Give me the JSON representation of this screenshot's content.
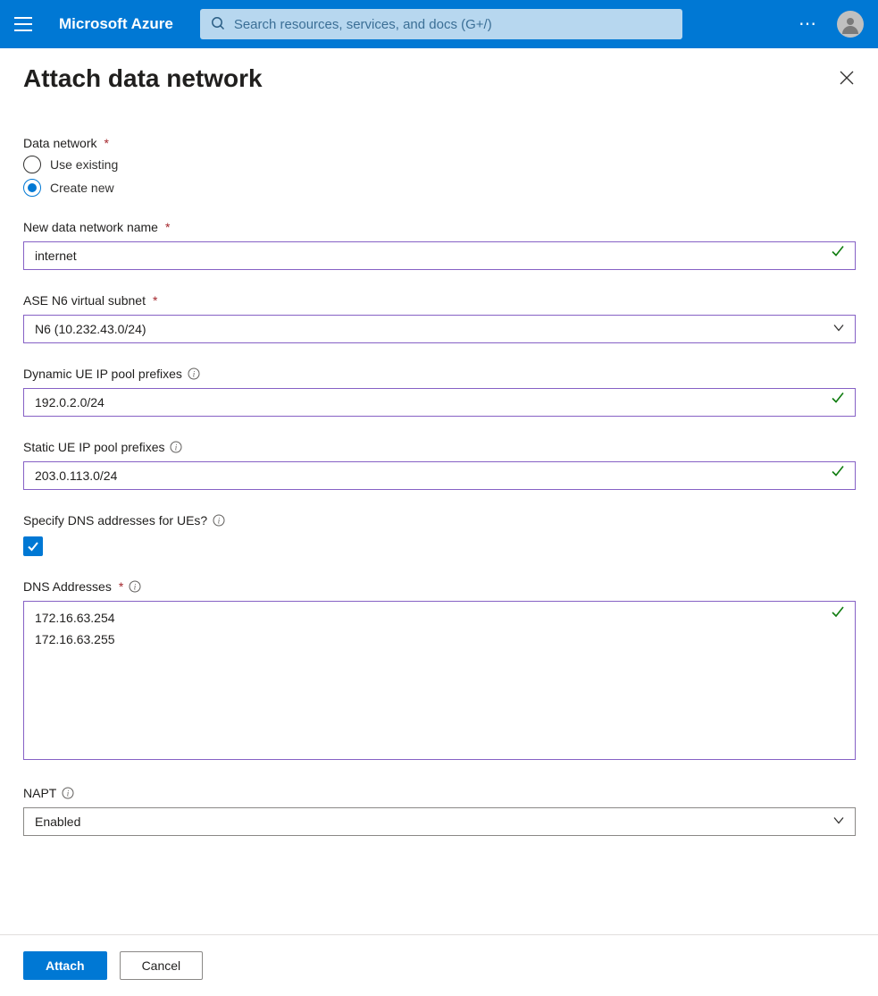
{
  "header": {
    "brand": "Microsoft Azure",
    "search_placeholder": "Search resources, services, and docs (G+/)"
  },
  "page": {
    "title": "Attach data network"
  },
  "form": {
    "data_network_label": "Data network",
    "radio_existing": "Use existing",
    "radio_create": "Create new",
    "radio_selected": "create",
    "name_label": "New data network name",
    "name_value": "internet",
    "subnet_label": "ASE N6 virtual subnet",
    "subnet_value": "N6 (10.232.43.0/24)",
    "dyn_label": "Dynamic UE IP pool prefixes",
    "dyn_value": "192.0.2.0/24",
    "static_label": "Static UE IP pool prefixes",
    "static_value": "203.0.113.0/24",
    "dns_specify_label": "Specify DNS addresses for UEs?",
    "dns_specify_checked": true,
    "dns_label": "DNS Addresses",
    "dns_value": "172.16.63.254\n172.16.63.255",
    "napt_label": "NAPT",
    "napt_value": "Enabled"
  },
  "footer": {
    "attach": "Attach",
    "cancel": "Cancel"
  }
}
